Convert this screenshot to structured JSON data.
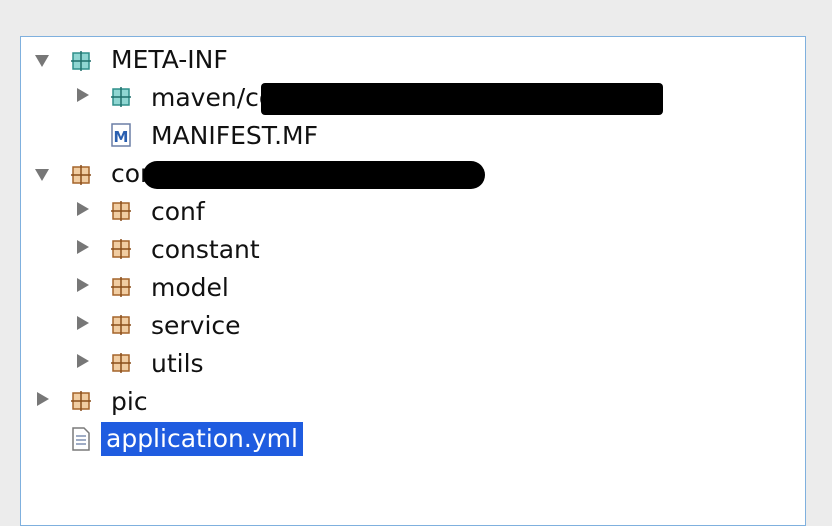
{
  "tree": {
    "items": [
      {
        "label": "META-INF",
        "icon": "source-folder-icon",
        "expanded": true
      },
      {
        "label": "maven/co",
        "icon": "source-folder-icon",
        "expanded": false
      },
      {
        "label": "MANIFEST.MF",
        "icon": "manifest-file-icon"
      },
      {
        "label": "com",
        "icon": "package-icon",
        "expanded": true
      },
      {
        "label": "conf",
        "icon": "package-icon",
        "expanded": false
      },
      {
        "label": "constant",
        "icon": "package-icon",
        "expanded": false
      },
      {
        "label": "model",
        "icon": "package-icon",
        "expanded": false
      },
      {
        "label": "service",
        "icon": "package-icon",
        "expanded": false
      },
      {
        "label": "utils",
        "icon": "package-icon",
        "expanded": false
      },
      {
        "label": "pic",
        "icon": "package-icon",
        "expanded": false
      },
      {
        "label": "application.yml",
        "icon": "text-file-icon",
        "selected": true
      }
    ],
    "manifest_icon_letter": "M"
  },
  "colors": {
    "selection": "#1f5ce0",
    "source_folder": "#3aa5a0",
    "package": "#c9874a",
    "panel_border": "#7fb0de"
  }
}
